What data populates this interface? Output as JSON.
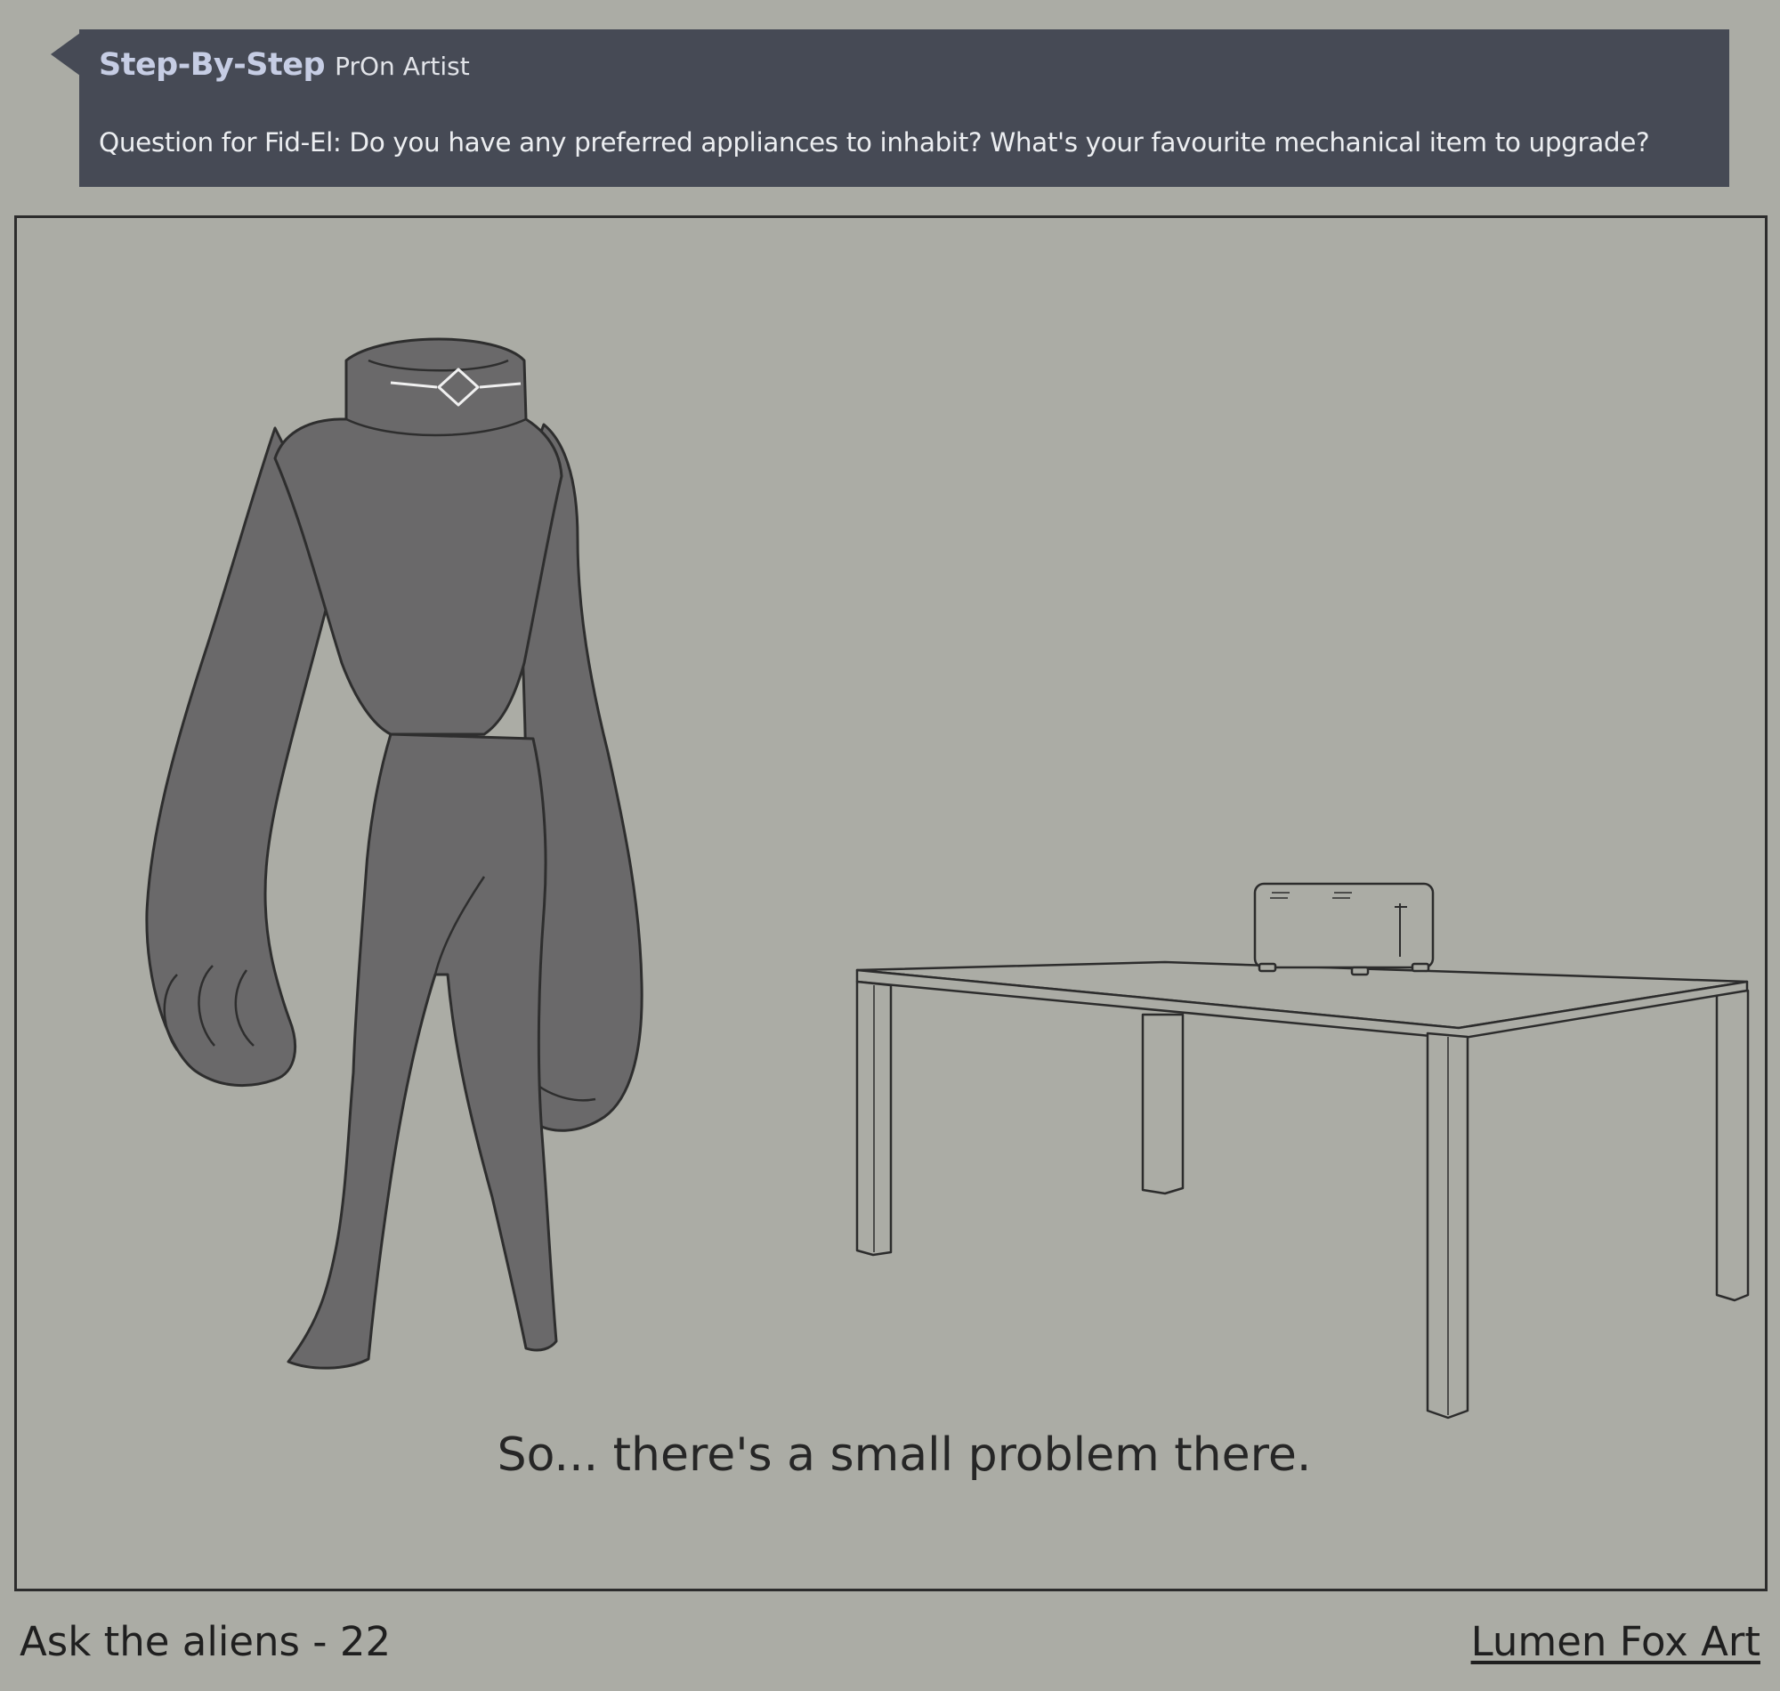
{
  "comment": {
    "author": "Step-By-Step",
    "role": "PrOn Artist",
    "text": "Question for Fid-El: Do you have any preferred appliances to inhabit? What's your favourite mechanical item to upgrade?"
  },
  "panel": {
    "caption": "So... there's a small problem there."
  },
  "footer": {
    "title": "Ask the aliens - 22",
    "credit": "Lumen Fox Art"
  },
  "colors": {
    "background": "#abaca5",
    "comment_box": "#464a55",
    "author_name": "#c6cde4",
    "alien_body": "#6a696a",
    "panel_border": "#2c2c2c"
  },
  "icons": {
    "comment_tab": "speech-pointer"
  }
}
